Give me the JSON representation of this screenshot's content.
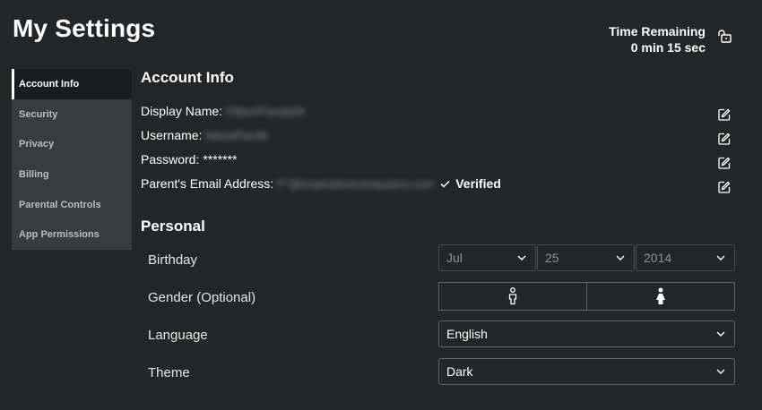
{
  "page": {
    "title": "My Settings"
  },
  "timer": {
    "label": "Time Remaining",
    "value": "0 min 15 sec"
  },
  "sidebar": {
    "items": [
      {
        "label": "Account Info",
        "active": true
      },
      {
        "label": "Security"
      },
      {
        "label": "Privacy"
      },
      {
        "label": "Billing"
      },
      {
        "label": "Parental Controls"
      },
      {
        "label": "App Permissions"
      }
    ]
  },
  "account_info": {
    "title": "Account Info",
    "display_name": {
      "label": "Display Name:",
      "value": "FilbertPanda06"
    },
    "username": {
      "label": "Username:",
      "value": "MariaPan3k"
    },
    "password": {
      "label": "Password:",
      "value": "*******"
    },
    "parent_email": {
      "label": "Parent's Email Address:",
      "value": "f**@inspirationcomputers.com",
      "status": "Verified"
    }
  },
  "personal": {
    "title": "Personal",
    "birthday": {
      "label": "Birthday",
      "month": "Jul",
      "day": "25",
      "year": "2014"
    },
    "gender": {
      "label": "Gender (Optional)"
    },
    "language": {
      "label": "Language",
      "value": "English"
    },
    "theme": {
      "label": "Theme",
      "value": "Dark"
    }
  },
  "colors": {
    "background": "#232527",
    "sidebar": "#393b3d",
    "active_item": "#191b1d",
    "border": "#62656a"
  }
}
